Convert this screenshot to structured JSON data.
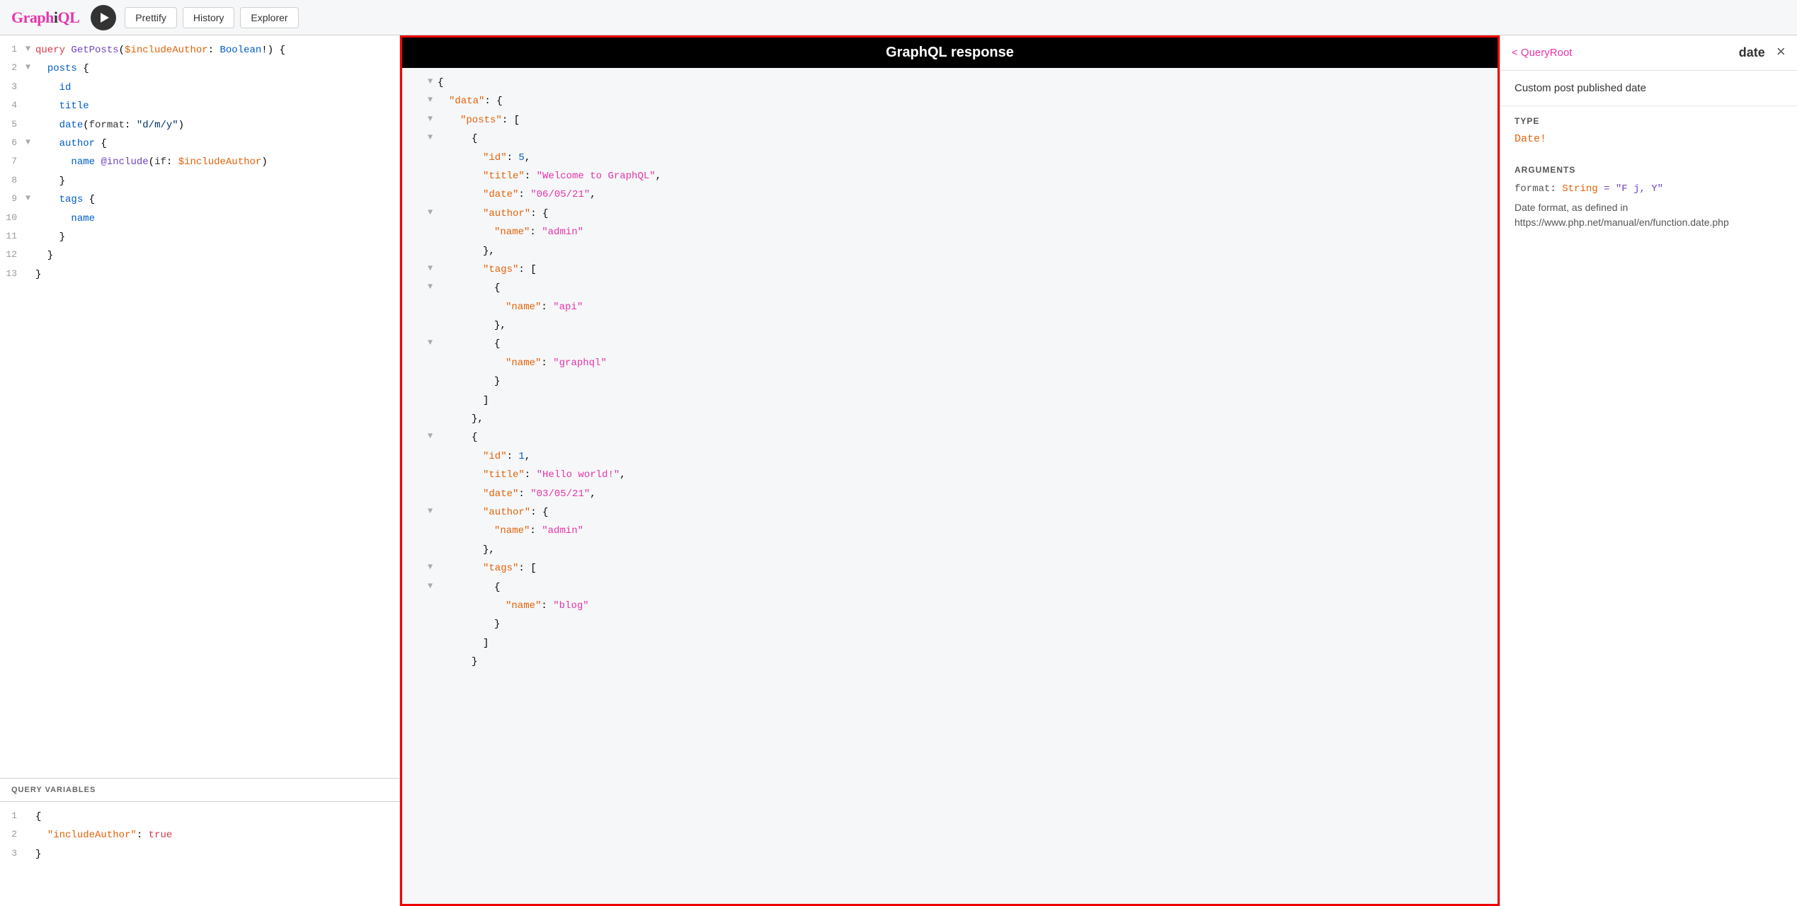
{
  "header": {
    "logo_graphi": "GraphiQL",
    "prettify_label": "Prettify",
    "history_label": "History",
    "explorer_label": "Explorer"
  },
  "query_editor": {
    "lines": [
      {
        "num": 1,
        "arrow": "▼",
        "content_html": "<span class='kw-query'>query</span> <span class='kw-name'>GetPosts</span>(<span class='kw-var'>$includeAuthor</span>: <span class='kw-type'>Boolean</span>!) {"
      },
      {
        "num": 2,
        "arrow": "▼",
        "content_html": "  <span class='kw-field'>posts</span> {"
      },
      {
        "num": 3,
        "arrow": "",
        "content_html": "    <span class='kw-field'>id</span>"
      },
      {
        "num": 4,
        "arrow": "",
        "content_html": "    <span class='kw-field'>title</span>"
      },
      {
        "num": 5,
        "arrow": "",
        "content_html": "    <span class='kw-field'>date</span>(<span class='kw-plain'>format</span>: <span class='kw-string'>\"d/m/y\"</span>)"
      },
      {
        "num": 6,
        "arrow": "▼",
        "content_html": "    <span class='kw-field'>author</span> {"
      },
      {
        "num": 7,
        "arrow": "",
        "content_html": "      <span class='kw-field'>name</span> <span class='kw-directive'>@include</span>(<span class='kw-plain'>if</span>: <span class='kw-var'>$includeAuthor</span>)"
      },
      {
        "num": 8,
        "arrow": "",
        "content_html": "    }"
      },
      {
        "num": 9,
        "arrow": "▼",
        "content_html": "    <span class='kw-field'>tags</span> {"
      },
      {
        "num": 10,
        "arrow": "",
        "content_html": "      <span class='kw-field'>name</span>"
      },
      {
        "num": 11,
        "arrow": "",
        "content_html": "    }"
      },
      {
        "num": 12,
        "arrow": "",
        "content_html": "  }"
      },
      {
        "num": 13,
        "arrow": "",
        "content_html": "}"
      }
    ]
  },
  "query_variables": {
    "section_label": "QUERY VARIABLES",
    "lines": [
      {
        "num": 1,
        "arrow": "",
        "content_html": "{"
      },
      {
        "num": 2,
        "arrow": "",
        "content_html": "  <span class='json-key'>\"includeAuthor\"</span>: <span class='json-bool'>true</span>"
      },
      {
        "num": 3,
        "arrow": "",
        "content_html": "}"
      }
    ]
  },
  "response": {
    "header": "GraphQL response",
    "lines": [
      {
        "num": null,
        "arrow": "▼",
        "indent": 0,
        "content_html": "{"
      },
      {
        "num": null,
        "arrow": "▼",
        "indent": 2,
        "content_html": "<span class='json-key'>\"data\"</span>: {"
      },
      {
        "num": null,
        "arrow": "▼",
        "indent": 4,
        "content_html": "<span class='json-key'>\"posts\"</span>: ["
      },
      {
        "num": null,
        "arrow": "▼",
        "indent": 6,
        "content_html": "{"
      },
      {
        "num": null,
        "arrow": "",
        "indent": 8,
        "content_html": "<span class='json-key'>\"id\"</span>: <span class='json-num'>5</span>,"
      },
      {
        "num": null,
        "arrow": "",
        "indent": 8,
        "content_html": "<span class='json-key'>\"title\"</span>: <span class='json-str'>\"Welcome to GraphQL\"</span>,"
      },
      {
        "num": null,
        "arrow": "",
        "indent": 8,
        "content_html": "<span class='json-key'>\"date\"</span>: <span class='json-str'>\"06/05/21\"</span>,"
      },
      {
        "num": null,
        "arrow": "▼",
        "indent": 8,
        "content_html": "<span class='json-key'>\"author\"</span>: {"
      },
      {
        "num": null,
        "arrow": "",
        "indent": 10,
        "content_html": "<span class='json-key'>\"name\"</span>: <span class='json-str'>\"admin\"</span>"
      },
      {
        "num": null,
        "arrow": "",
        "indent": 8,
        "content_html": "},"
      },
      {
        "num": null,
        "arrow": "▼",
        "indent": 8,
        "content_html": "<span class='json-key'>\"tags\"</span>: ["
      },
      {
        "num": null,
        "arrow": "▼",
        "indent": 10,
        "content_html": "{"
      },
      {
        "num": null,
        "arrow": "",
        "indent": 12,
        "content_html": "<span class='json-key'>\"name\"</span>: <span class='json-str'>\"api\"</span>"
      },
      {
        "num": null,
        "arrow": "",
        "indent": 10,
        "content_html": "},"
      },
      {
        "num": null,
        "arrow": "▼",
        "indent": 10,
        "content_html": "{"
      },
      {
        "num": null,
        "arrow": "",
        "indent": 12,
        "content_html": "<span class='json-key'>\"name\"</span>: <span class='json-str'>\"graphql\"</span>"
      },
      {
        "num": null,
        "arrow": "",
        "indent": 10,
        "content_html": "}"
      },
      {
        "num": null,
        "arrow": "",
        "indent": 8,
        "content_html": "]"
      },
      {
        "num": null,
        "arrow": "",
        "indent": 6,
        "content_html": "},"
      },
      {
        "num": null,
        "arrow": "▼",
        "indent": 6,
        "content_html": "{"
      },
      {
        "num": null,
        "arrow": "",
        "indent": 8,
        "content_html": "<span class='json-key'>\"id\"</span>: <span class='json-num'>1</span>,"
      },
      {
        "num": null,
        "arrow": "",
        "indent": 8,
        "content_html": "<span class='json-key'>\"title\"</span>: <span class='json-str'>\"Hello world!\"</span>,"
      },
      {
        "num": null,
        "arrow": "",
        "indent": 8,
        "content_html": "<span class='json-key'>\"date\"</span>: <span class='json-str'>\"03/05/21\"</span>,"
      },
      {
        "num": null,
        "arrow": "▼",
        "indent": 8,
        "content_html": "<span class='json-key'>\"author\"</span>: {"
      },
      {
        "num": null,
        "arrow": "",
        "indent": 10,
        "content_html": "<span class='json-key'>\"name\"</span>: <span class='json-str'>\"admin\"</span>"
      },
      {
        "num": null,
        "arrow": "",
        "indent": 8,
        "content_html": "},"
      },
      {
        "num": null,
        "arrow": "▼",
        "indent": 8,
        "content_html": "<span class='json-key'>\"tags\"</span>: ["
      },
      {
        "num": null,
        "arrow": "▼",
        "indent": 10,
        "content_html": "{"
      },
      {
        "num": null,
        "arrow": "",
        "indent": 12,
        "content_html": "<span class='json-key'>\"name\"</span>: <span class='json-str'>\"blog\"</span>"
      },
      {
        "num": null,
        "arrow": "",
        "indent": 10,
        "content_html": "}"
      },
      {
        "num": null,
        "arrow": "",
        "indent": 8,
        "content_html": "]"
      },
      {
        "num": null,
        "arrow": "",
        "indent": 6,
        "content_html": "}"
      }
    ]
  },
  "docs": {
    "back_label": "< QueryRoot",
    "title": "date",
    "close_icon": "×",
    "description": "Custom post published date",
    "type_section": "TYPE",
    "type_value": "Date!",
    "arguments_section": "ARGUMENTS",
    "arg_name": "format",
    "arg_type": "String",
    "arg_default": "= \"F j, Y\"",
    "arg_description": "Date format, as defined in https://www.php.net/manual/en/function.date.php"
  }
}
